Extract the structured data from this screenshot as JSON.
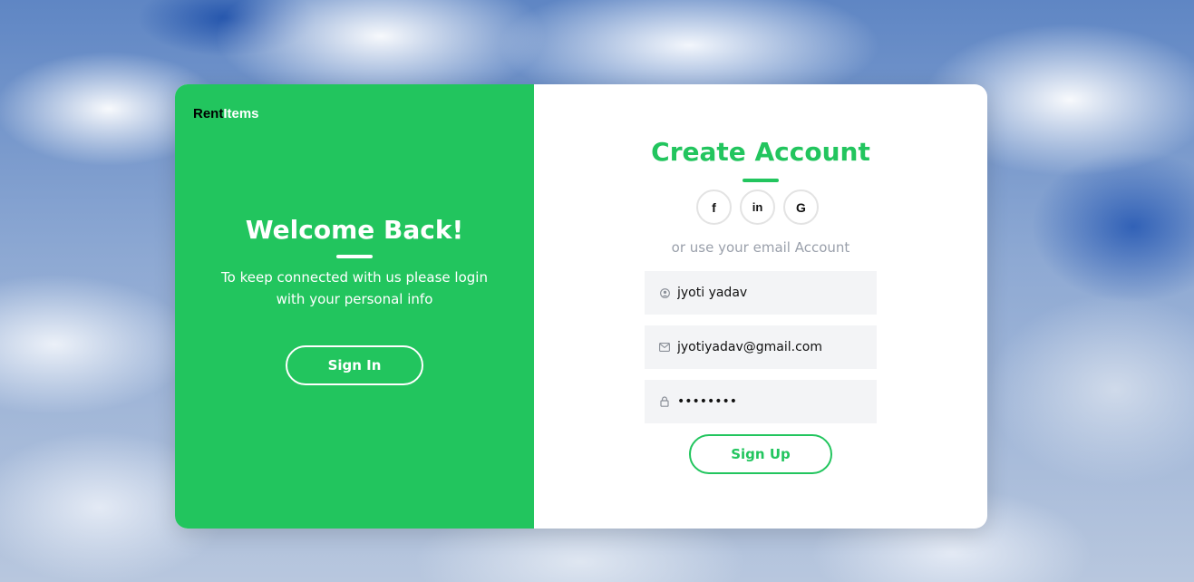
{
  "logo": {
    "part1": "Rent",
    "part2": "Items"
  },
  "left_panel": {
    "title": "Welcome Back!",
    "text": "To keep connected with us please login with your personal info",
    "signin_label": "Sign In",
    "color": "#22c55e"
  },
  "right_panel": {
    "title": "Create Account",
    "socials": [
      {
        "icon": "facebook-icon",
        "glyph": "f"
      },
      {
        "icon": "linkedin-icon",
        "glyph": "in"
      },
      {
        "icon": "google-icon",
        "glyph": "G"
      }
    ],
    "or_text": "or use your email Account",
    "name_value": "jyoti yadav",
    "email_value": "jyotiyadav@gmail.com",
    "password_value": "••••••••",
    "signup_label": "Sign Up"
  },
  "colors": {
    "accent": "#22c55e",
    "field_bg": "#f3f4f6",
    "muted_text": "#9aa0ab"
  }
}
